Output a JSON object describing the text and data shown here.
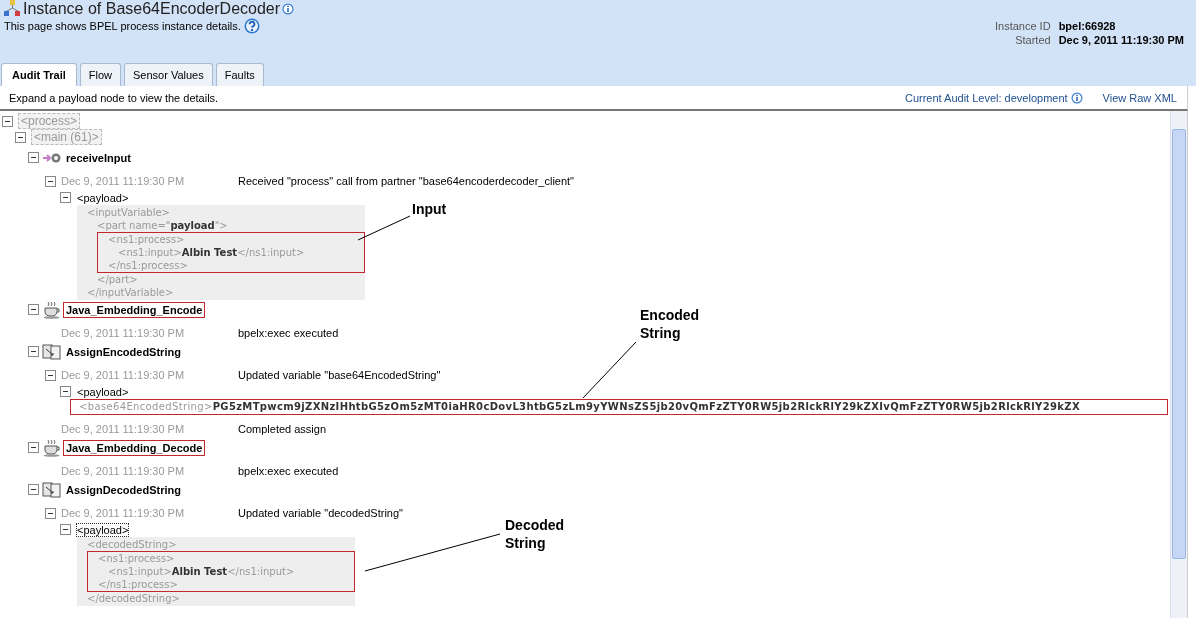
{
  "header": {
    "title": "Instance of Base64EncoderDecoder",
    "subtitle": "This page shows BPEL process instance details.",
    "instance_id_label": "Instance ID",
    "instance_id": "bpel:66928",
    "started_label": "Started",
    "started": "Dec 9, 2011 11:19:30 PM"
  },
  "tabs": [
    {
      "label": "Audit Trail",
      "selected": true
    },
    {
      "label": "Flow",
      "selected": false
    },
    {
      "label": "Sensor Values",
      "selected": false
    },
    {
      "label": "Faults",
      "selected": false
    }
  ],
  "toolbar": {
    "hint": "Expand a payload node to view the details.",
    "audit_level": "Current Audit Level: development",
    "view_raw": "View Raw XML"
  },
  "tree": [
    {
      "kind": "group",
      "label": "<process>",
      "expanded": true,
      "children": [
        {
          "kind": "group",
          "label": "<main (61)>",
          "expanded": true,
          "children": [
            {
              "kind": "receive",
              "label": "receiveInput",
              "expanded": true,
              "highlighted": false,
              "children": [
                {
                  "kind": "event",
                  "time": "Dec 9, 2011 11:19:30 PM",
                  "message": "Received \"process\" call from partner \"base64encoderdecoder_client\"",
                  "expanded": true,
                  "payload": {
                    "label": "<payload>",
                    "expanded": true,
                    "focused": false,
                    "xml": [
                      {
                        "open": "<inputVariable>",
                        "close": "</inputVariable>",
                        "children": [
                          {
                            "open": "<part  name=\"**payload**\">",
                            "close": "</part>",
                            "children": [
                              {
                                "open": "<ns1:process>",
                                "close": "</ns1:process>",
                                "highlighted": true,
                                "children": [
                                  {
                                    "line": "<ns1:input>**Albin Test**</ns1:input>"
                                  }
                                ]
                              }
                            ]
                          }
                        ]
                      }
                    ]
                  }
                }
              ]
            },
            {
              "kind": "java",
              "label": "Java_Embedding_Encode",
              "expanded": true,
              "highlighted": true,
              "children": [
                {
                  "kind": "event",
                  "time": "Dec 9, 2011 11:19:30 PM",
                  "message": "bpelx:exec executed"
                }
              ]
            },
            {
              "kind": "assign",
              "label": "AssignEncodedString",
              "expanded": true,
              "highlighted": false,
              "children": [
                {
                  "kind": "event",
                  "time": "Dec 9, 2011 11:19:30 PM",
                  "message": "Updated variable \"base64EncodedString\"",
                  "expanded": true,
                  "payload": {
                    "label": "<payload>",
                    "expanded": true,
                    "focused": false,
                    "xml": [
                      {
                        "line": "<base64EncodedString>**PG5zMTpwcm9jZXNzIHhtbG5zOm5zMT0iaHR0cDovL3htbG5zLm9yYWNsZS5jb20vQmFzZTY0RW5jb2RlckRlY29kZXIvQmFzZTY0RW5jb2RlckRlY29kZX**",
                        "highlighted": true
                      }
                    ]
                  }
                },
                {
                  "kind": "event",
                  "time": "Dec 9, 2011 11:19:30 PM",
                  "message": "Completed assign"
                }
              ]
            },
            {
              "kind": "java",
              "label": "Java_Embedding_Decode",
              "expanded": true,
              "highlighted": true,
              "children": [
                {
                  "kind": "event",
                  "time": "Dec 9, 2011 11:19:30 PM",
                  "message": "bpelx:exec executed"
                }
              ]
            },
            {
              "kind": "assign",
              "label": "AssignDecodedString",
              "expanded": true,
              "highlighted": false,
              "children": [
                {
                  "kind": "event",
                  "time": "Dec 9, 2011 11:19:30 PM",
                  "message": "Updated variable \"decodedString\"",
                  "expanded": true,
                  "payload": {
                    "label": "<payload>",
                    "expanded": true,
                    "focused": true,
                    "xml": [
                      {
                        "open": "<decodedString>",
                        "close": "</decodedString>",
                        "children": [
                          {
                            "open": "<ns1:process>",
                            "close": "</ns1:process>",
                            "highlighted": true,
                            "children": [
                              {
                                "line": "<ns1:input>**Albin Test**</ns1:input>"
                              }
                            ]
                          }
                        ]
                      }
                    ]
                  }
                }
              ]
            }
          ]
        }
      ]
    }
  ],
  "annotations": [
    "Input",
    "Encoded\nString",
    "Decoded\nString"
  ]
}
